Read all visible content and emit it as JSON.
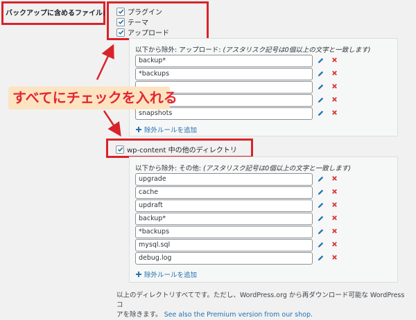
{
  "include_label": "バックアップに含めるファイル:",
  "include_options": [
    {
      "label": "プラグイン",
      "checked": true
    },
    {
      "label": "テーマ",
      "checked": true
    },
    {
      "label": "アップロード",
      "checked": true
    }
  ],
  "uploads_exclude": {
    "title_prefix": "以下から除外: アップロード:",
    "title_hint": "(アスタリスク記号は0個以上の文字と一致します)",
    "items": [
      "backup*",
      "*backups",
      "",
      "",
      "snapshots"
    ],
    "add_label": "除外ルールを追加"
  },
  "callout_text": "すべてにチェックを入れる",
  "other_dirs": {
    "label": "wp-content 中の他のディレクトリ",
    "checked": true
  },
  "others_exclude": {
    "title_prefix": "以下から除外: その他:",
    "title_hint": "(アスタリスク記号は0個以上の文字と一致します)",
    "items": [
      "upgrade",
      "cache",
      "updraft",
      "backup*",
      "*backups",
      "mysql.sql",
      "debug.log"
    ],
    "add_label": "除外ルールを追加"
  },
  "footer": {
    "line1": "以上のディレクトリすべてです。ただし、WordPress.org から再ダウンロード可能な WordPress コ",
    "line2": "アを除きます。",
    "link": "See also the Premium version from our shop."
  },
  "colors": {
    "accent_red": "#d8232a",
    "link_blue": "#2271b1",
    "delete_orange": "#d63638",
    "callout_bg": "#fce3c2"
  }
}
